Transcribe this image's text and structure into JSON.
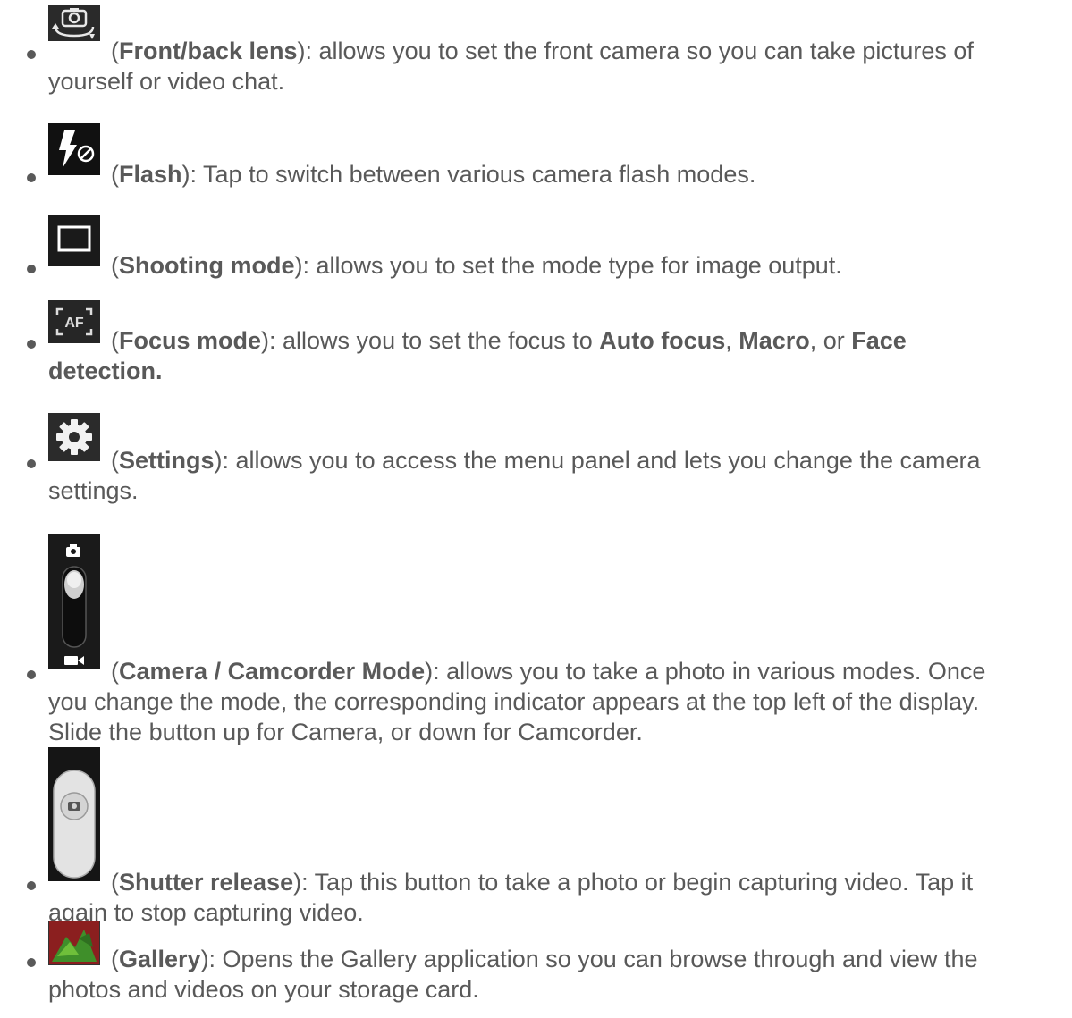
{
  "items": [
    {
      "icon": "front-back-lens-icon",
      "name": "Front/back lens",
      "desc_line1": "): allows you to set the front camera so you can take pictures of",
      "desc_line2": "yourself or video chat."
    },
    {
      "icon": "flash-icon",
      "name": "Flash",
      "desc_line1": "): Tap to switch between various camera flash modes."
    },
    {
      "icon": "shooting-mode-icon",
      "name": "Shooting mode",
      "desc_line1": "): allows you to set the mode type for image output."
    },
    {
      "icon": "focus-mode-icon",
      "name": "Focus mode",
      "desc_pre": "): allows you to set the focus to ",
      "opt1": "Auto focus",
      "sep1": ", ",
      "opt2": "Macro",
      "sep2": ", or ",
      "opt3": "Face",
      "opt3_line2": "detection."
    },
    {
      "icon": "settings-gear-icon",
      "name": "Settings",
      "desc_line1": "): allows you to access the menu panel and lets you change the camera",
      "desc_line2": "settings."
    },
    {
      "icon": "camera-camcorder-switch-icon",
      "name": "Camera / Camcorder Mode",
      "desc_line1": "): allows you to take a photo in various modes. Once",
      "desc_line2": "you change the mode, the corresponding indicator appears at the top left of the display.",
      "desc_line3": "Slide the button up for Camera, or down for Camcorder."
    },
    {
      "icon": "shutter-release-icon",
      "name": "Shutter release",
      "desc_line1": "): Tap this button to take a photo or begin capturing video. Tap it",
      "desc_line2": "again to stop capturing video."
    },
    {
      "icon": "gallery-thumbnail-icon",
      "name": "Gallery",
      "desc_line1": "): Opens the Gallery application so you can browse through and view the",
      "desc_line2": "photos and videos on your storage card."
    }
  ],
  "open_paren": "("
}
